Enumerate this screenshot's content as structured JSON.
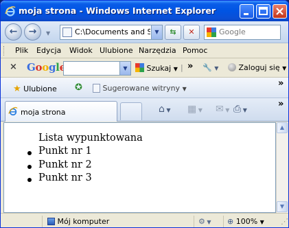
{
  "window": {
    "title": "moja strona - Windows Internet Explorer"
  },
  "address_bar": {
    "url": "C:\\Documents and Set"
  },
  "search": {
    "placeholder": "Google"
  },
  "menu": {
    "items": [
      "Plik",
      "Edycja",
      "Widok",
      "Ulubione",
      "Narzędzia",
      "Pomoc"
    ]
  },
  "google_toolbar": {
    "logo": "Google",
    "search_label": "Szukaj",
    "signin_label": "Zaloguj się"
  },
  "favorites_bar": {
    "favorites_label": "Ulubione",
    "suggested_label": "Sugerowane witryny"
  },
  "tab": {
    "label": "moja strona"
  },
  "page": {
    "heading": "Lista wypunktowana",
    "items": [
      "Punkt nr 1",
      "Punkt nr 2",
      "Punkt nr 3"
    ]
  },
  "status": {
    "zone": "Mój komputer",
    "zoom": "100%"
  },
  "icons": {
    "ie": "ie-logo-icon",
    "back": "back-arrow-icon",
    "forward": "forward-arrow-icon",
    "refresh": "refresh-icon",
    "stop": "stop-icon",
    "home": "home-icon",
    "feeds": "rss-feed-icon",
    "mail": "mail-icon",
    "print": "print-icon",
    "star": "star-icon",
    "wrench": "wrench-icon",
    "computer": "computer-icon"
  },
  "colors": {
    "titlebar": "#0054e3",
    "accent": "#316ac5"
  }
}
